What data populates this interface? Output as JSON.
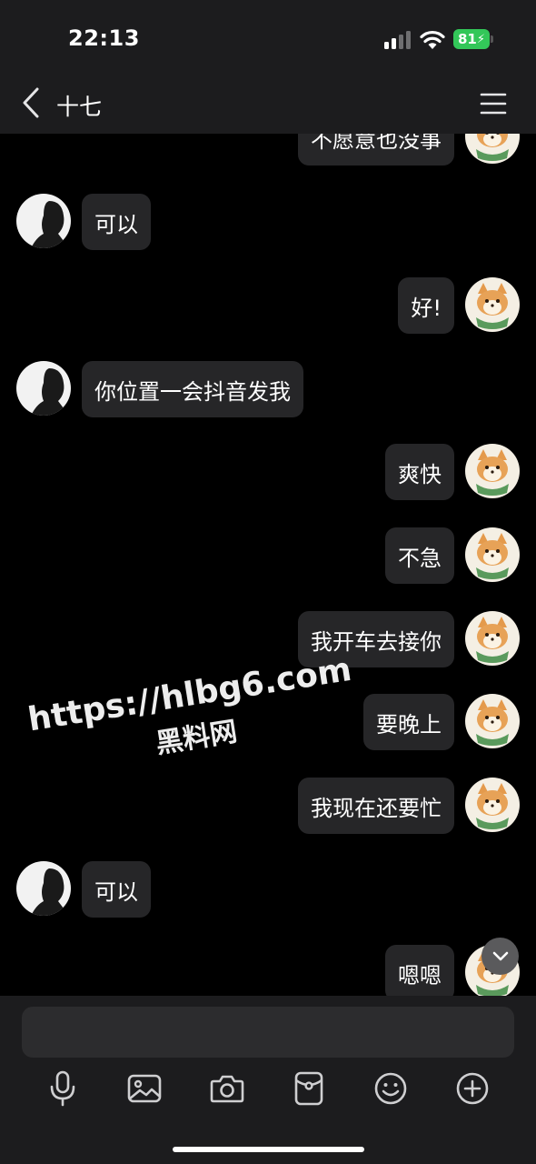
{
  "status_bar": {
    "time": "22:13",
    "battery_level": "81",
    "battery_color": "#33c759"
  },
  "header": {
    "contact_name": "十七",
    "back_icon": "chevron-left-icon",
    "menu_icon": "hamburger-menu-icon"
  },
  "messages": [
    {
      "side": "out",
      "text": "不愿意也没事"
    },
    {
      "side": "in",
      "text": "可以"
    },
    {
      "side": "out",
      "text": "好!"
    },
    {
      "side": "in",
      "text": "你位置一会抖音发我"
    },
    {
      "side": "out",
      "text": "爽快"
    },
    {
      "side": "out",
      "text": "不急"
    },
    {
      "side": "out",
      "text": "我开车去接你"
    },
    {
      "side": "out",
      "text": "要晚上"
    },
    {
      "side": "out",
      "text": "我现在还要忙"
    },
    {
      "side": "in",
      "text": "可以"
    },
    {
      "side": "out",
      "text": "嗯嗯"
    }
  ],
  "watermark": {
    "line1": "https://hlbg6.com",
    "line2": "黑料网"
  },
  "composer": {
    "placeholder": ""
  },
  "toolbar": {
    "icons": [
      "microphone-icon",
      "image-icon",
      "camera-icon",
      "red-packet-icon",
      "emoji-icon",
      "plus-icon"
    ]
  }
}
